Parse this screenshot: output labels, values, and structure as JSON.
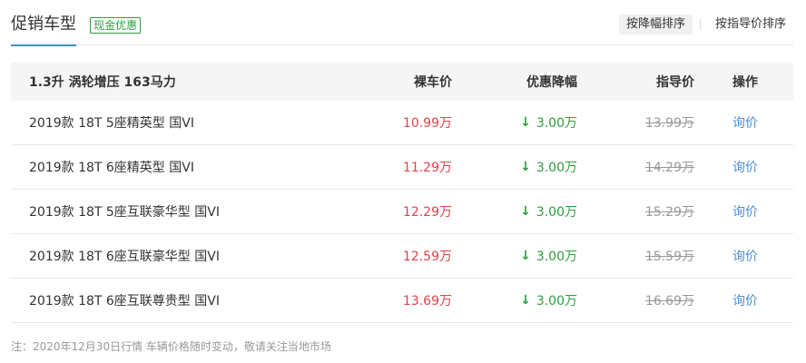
{
  "header": {
    "title": "促销车型",
    "badge": "现金优惠",
    "sort_options": [
      "按降幅排序",
      "按指导价排序"
    ],
    "active_sort": 0
  },
  "table": {
    "group_title": "1.3升 涡轮增压 163马力",
    "columns": {
      "price": "裸车价",
      "discount": "优惠降幅",
      "guide": "指导价",
      "action": "操作"
    },
    "rows": [
      {
        "name": "2019款 18T 5座精英型 国VI",
        "price": "10.99万",
        "discount": "3.00万",
        "guide": "13.99万",
        "action": "询价"
      },
      {
        "name": "2019款 18T 6座精英型 国VI",
        "price": "11.29万",
        "discount": "3.00万",
        "guide": "14.29万",
        "action": "询价"
      },
      {
        "name": "2019款 18T 5座互联豪华型 国VI",
        "price": "12.29万",
        "discount": "3.00万",
        "guide": "15.29万",
        "action": "询价"
      },
      {
        "name": "2019款 18T 6座互联豪华型 国VI",
        "price": "12.59万",
        "discount": "3.00万",
        "guide": "15.59万",
        "action": "询价"
      },
      {
        "name": "2019款 18T 6座互联尊贵型 国VI",
        "price": "13.69万",
        "discount": "3.00万",
        "guide": "16.69万",
        "action": "询价"
      }
    ]
  },
  "note": "注：2020年12月30日行情 车辆价格随时变动，敬请关注当地市场",
  "icons": {
    "discount_arrow": "arrow-down-icon"
  },
  "colors": {
    "price": "#e0434a",
    "discount": "#2e9e3b",
    "link": "#4a90d9",
    "accent": "#3a8ee6"
  }
}
